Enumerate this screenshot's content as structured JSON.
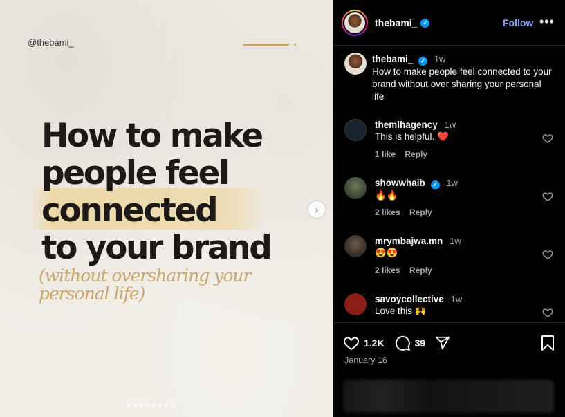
{
  "media": {
    "handle": "@thebami_",
    "headline_lines": [
      "How to make",
      "people feel",
      "connected",
      "to your brand"
    ],
    "subhead_lines": [
      "(without oversharing your",
      "personal life)"
    ],
    "accent_color": "#cda66e",
    "carousel_dots": 8,
    "next_icon": "chevron-right-icon"
  },
  "header": {
    "username": "thebami_",
    "verified": true,
    "follow_label": "Follow",
    "more_label": "•••"
  },
  "caption": {
    "username": "thebami_",
    "time": "1w",
    "text": "How to make people feel connected to your brand without over sharing your personal life"
  },
  "comments": [
    {
      "username": "themlhagency",
      "time": "1w",
      "text": "This is helpful. ❤️",
      "likes": "1 like",
      "reply": "Reply",
      "verified": false
    },
    {
      "username": "showwhaib",
      "time": "1w",
      "text": "🔥🔥",
      "likes": "2 likes",
      "reply": "Reply",
      "verified": true
    },
    {
      "username": "mrymbajwa.mn",
      "time": "1w",
      "text": "😍😍",
      "likes": "2 likes",
      "reply": "Reply",
      "verified": false
    },
    {
      "username": "savoycollective",
      "time": "1w",
      "text": "Love this 🙌",
      "likes": "",
      "reply": "",
      "verified": false
    }
  ],
  "actions": {
    "like_count": "1.2K",
    "comment_count": "39",
    "date": "January 16"
  },
  "colors": {
    "background": "#000000",
    "link_blue": "#85a1ff",
    "verified_blue": "#0095f6",
    "muted": "#a8a8a8"
  }
}
